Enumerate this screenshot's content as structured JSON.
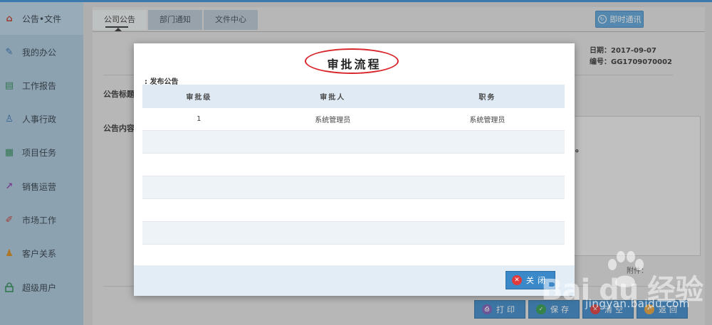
{
  "sidebar": {
    "items": [
      {
        "label": "公告•文件",
        "icon": "home-icon",
        "color": "#c0392b",
        "glyph": "⌂"
      },
      {
        "label": "我的办公",
        "icon": "edit-icon",
        "color": "#2c6fad",
        "glyph": "✎"
      },
      {
        "label": "工作报告",
        "icon": "report-icon",
        "color": "#2e8b57",
        "glyph": "▤"
      },
      {
        "label": "人事行政",
        "icon": "person-icon",
        "color": "#2c6fad",
        "glyph": "♙"
      },
      {
        "label": "项目任务",
        "icon": "grid-icon",
        "color": "#2e8b57",
        "glyph": "▦"
      },
      {
        "label": "销售运营",
        "icon": "chart-icon",
        "color": "#8e44ad",
        "glyph": "↗"
      },
      {
        "label": "市场工作",
        "icon": "tool-icon",
        "color": "#c0392b",
        "glyph": "✐"
      },
      {
        "label": "客户关系",
        "icon": "people-icon",
        "color": "#d58a1a",
        "glyph": "♟"
      },
      {
        "label": "超级用户",
        "icon": "lock-icon",
        "color": "#2e8b57",
        "glyph": "🔒"
      }
    ]
  },
  "tabs": [
    "公司公告",
    "部门通知",
    "文件中心"
  ],
  "im_button": "即时通讯",
  "meta": {
    "date": "日期：2017-09-07",
    "number": "编号：GG1709070002"
  },
  "form": {
    "title_label": "公告标题",
    "content_label": "公告内容",
    "attach": "附件："
  },
  "bottom_buttons": [
    {
      "label": "打印",
      "icon": "print-icon",
      "color": "#7d5ab8"
    },
    {
      "label": "保存",
      "icon": "check-icon",
      "color": "#2e9c4a"
    },
    {
      "label": "清空",
      "icon": "clear-icon",
      "color": "#e03a3a"
    },
    {
      "label": "返回",
      "icon": "back-icon",
      "color": "#e8a23a"
    }
  ],
  "modal": {
    "title": "审批流程",
    "subtitle": ": 发布公告",
    "columns": [
      "审批级",
      "审批人",
      "职务"
    ],
    "rows": [
      [
        "1",
        "系统管理员",
        "系统管理员"
      ],
      [
        "",
        "",
        ""
      ],
      [
        "",
        "",
        ""
      ],
      [
        "",
        "",
        ""
      ],
      [
        "",
        "",
        ""
      ],
      [
        "",
        "",
        ""
      ],
      [
        "",
        "",
        ""
      ]
    ],
    "close_label": "关闭"
  },
  "watermark": {
    "brand": "Bai du 经验",
    "url": "jingyan.baidu.com"
  }
}
